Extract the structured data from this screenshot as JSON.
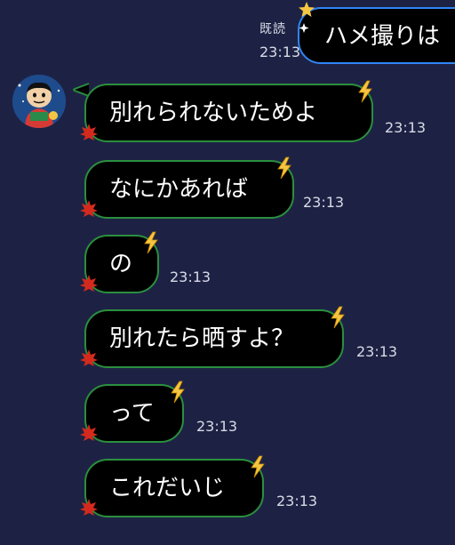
{
  "sent": {
    "read_label": "既読",
    "time": "23:13",
    "text": "ハメ撮りは"
  },
  "received": [
    {
      "text": "別れられないためよ",
      "time": "23:13"
    },
    {
      "text": "なにかあれば",
      "time": "23:13"
    },
    {
      "text": "の",
      "time": "23:13"
    },
    {
      "text": "別れたら晒すよ？",
      "time": "23:13"
    },
    {
      "text": "って",
      "time": "23:13"
    },
    {
      "text": "これだいじ",
      "time": "23:13"
    }
  ],
  "colors": {
    "background": "#1d2244",
    "bubble_fill": "#000000",
    "received_border": "#2b8f3e",
    "sent_border": "#2f86f6",
    "text": "#ffffff",
    "meta_text": "#d9dbe6"
  },
  "icons": [
    "star-sparkle-icon",
    "lightning-icon",
    "maple-leaf-icon",
    "avatar"
  ]
}
